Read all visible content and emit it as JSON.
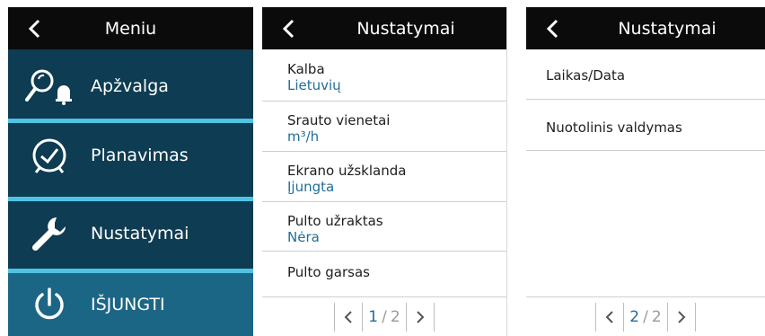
{
  "menu": {
    "title": "Meniu",
    "items": [
      {
        "label": "Apžvalga",
        "icon": "search-alarm-icon"
      },
      {
        "label": "Planavimas",
        "icon": "clock-icon"
      },
      {
        "label": "Nustatymai",
        "icon": "wrench-icon"
      },
      {
        "label": "IŠJUNGTI",
        "icon": "power-icon"
      }
    ],
    "colors": {
      "bg": "#0e3c52",
      "separator": "#4fc3e3",
      "power_bg": "#1b6685"
    }
  },
  "settings_page1": {
    "title": "Nustatymai",
    "rows": [
      {
        "title": "Kalba",
        "value": "Lietuvių"
      },
      {
        "title": "Srauto vienetai",
        "value": "m³/h"
      },
      {
        "title": "Ekrano užsklanda",
        "value": "Įjungta"
      },
      {
        "title": "Pulto užraktas",
        "value": "Nėra"
      },
      {
        "title": "Pulto garsas"
      }
    ],
    "pager": {
      "current": "1",
      "separator": "/",
      "total": "2"
    }
  },
  "settings_page2": {
    "title": "Nustatymai",
    "rows": [
      {
        "title": "Laikas/Data"
      },
      {
        "title": "Nuotolinis valdymas"
      }
    ],
    "pager": {
      "current": "2",
      "separator": "/",
      "total": "2"
    }
  },
  "colors": {
    "header": "#0b0b0b",
    "value_text": "#1f6e9a"
  }
}
